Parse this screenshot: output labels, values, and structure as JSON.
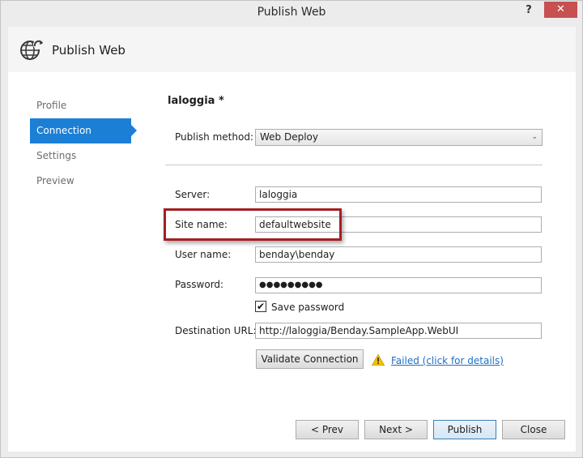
{
  "window": {
    "title": "Publish Web",
    "help_label": "?",
    "close_label": "✕"
  },
  "header": {
    "title": "Publish Web",
    "icon": "globe-publish-icon"
  },
  "nav": {
    "items": [
      {
        "label": "Profile"
      },
      {
        "label": "Connection",
        "active": true
      },
      {
        "label": "Settings"
      },
      {
        "label": "Preview"
      }
    ]
  },
  "profile_name": "laloggia *",
  "form": {
    "publish_method": {
      "label": "Publish method:",
      "value": "Web Deploy"
    },
    "server": {
      "label": "Server:",
      "value": "laloggia"
    },
    "site_name": {
      "label": "Site name:",
      "value": "defaultwebsite"
    },
    "user_name": {
      "label": "User name:",
      "value": "benday\\benday"
    },
    "password": {
      "label": "Password:",
      "value": "●●●●●●●●●"
    },
    "save_password": {
      "label": "Save password",
      "checked": true
    },
    "destination_url": {
      "label": "Destination URL:",
      "value": "http://laloggia/Benday.SampleApp.WebUI"
    }
  },
  "validate": {
    "button_label": "Validate Connection",
    "status_text": "Failed (click for details)",
    "status_icon": "warning-icon",
    "status_color": "#1f6fc5"
  },
  "footer": {
    "prev_label": "< Prev",
    "next_label": "Next >",
    "publish_label": "Publish",
    "close_label": "Close"
  },
  "colors": {
    "accent": "#1c7fd6",
    "highlight_border": "#a51e22",
    "close_button": "#c75050"
  }
}
